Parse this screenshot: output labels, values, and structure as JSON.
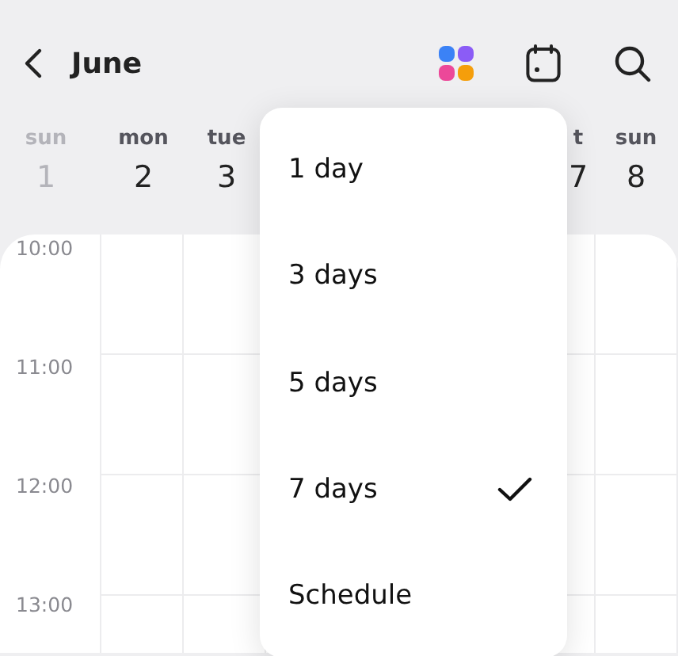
{
  "header": {
    "title": "June"
  },
  "days": [
    {
      "name": "sun",
      "number": "1",
      "muted": true
    },
    {
      "name": "mon",
      "number": "2",
      "muted": false
    },
    {
      "name": "tue",
      "number": "3",
      "muted": false
    },
    {
      "name": "t",
      "number": "7",
      "muted": false
    },
    {
      "name": "sun",
      "number": "8",
      "muted": false
    }
  ],
  "hours": [
    "10:00",
    "11:00",
    "12:00",
    "13:00"
  ],
  "view_menu": [
    {
      "label": "1 day",
      "selected": false
    },
    {
      "label": "3 days",
      "selected": false
    },
    {
      "label": "5 days",
      "selected": false
    },
    {
      "label": "7 days",
      "selected": true
    },
    {
      "label": "Schedule",
      "selected": false
    }
  ]
}
